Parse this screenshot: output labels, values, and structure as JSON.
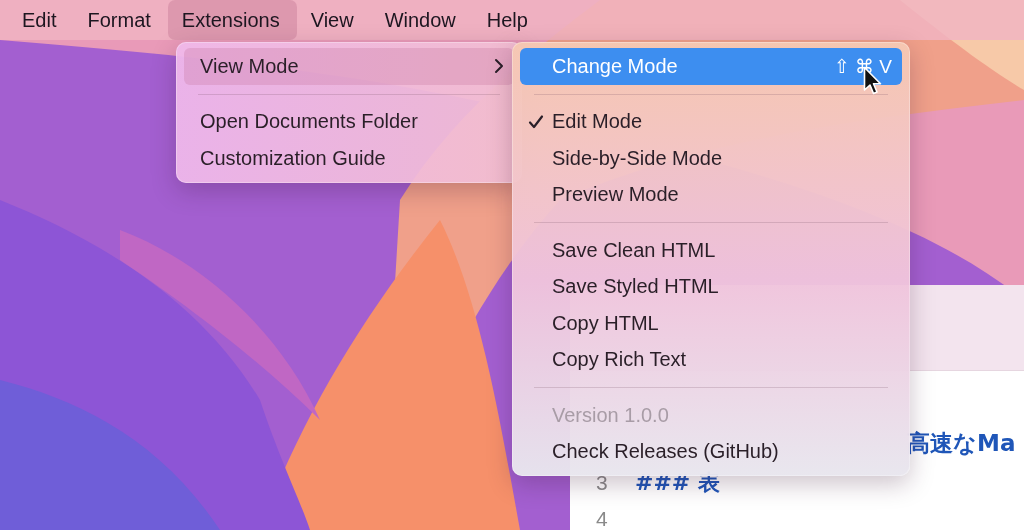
{
  "menu_bar": [
    {
      "label": "Edit",
      "selected": false
    },
    {
      "label": "Format",
      "selected": false
    },
    {
      "label": "Extensions",
      "selected": true
    },
    {
      "label": "View",
      "selected": false
    },
    {
      "label": "Window",
      "selected": false
    },
    {
      "label": "Help",
      "selected": false
    }
  ],
  "extensions_menu": {
    "items": [
      {
        "kind": "item",
        "label": "View Mode",
        "selected": true,
        "has_submenu": true
      },
      {
        "kind": "separator"
      },
      {
        "kind": "item",
        "label": "Open Documents Folder",
        "selected": false,
        "has_submenu": false
      },
      {
        "kind": "item",
        "label": "Customization Guide",
        "selected": false,
        "has_submenu": false
      }
    ]
  },
  "view_mode_submenu": {
    "items": [
      {
        "kind": "item",
        "label": "Change Mode",
        "selected": true,
        "checked": false,
        "disabled": false,
        "shortcut": "⇧ ⌘ V"
      },
      {
        "kind": "separator"
      },
      {
        "kind": "item",
        "label": "Edit Mode",
        "selected": false,
        "checked": true,
        "disabled": false
      },
      {
        "kind": "item",
        "label": "Side-by-Side Mode",
        "selected": false,
        "checked": false,
        "disabled": false
      },
      {
        "kind": "item",
        "label": "Preview Mode",
        "selected": false,
        "checked": false,
        "disabled": false
      },
      {
        "kind": "separator"
      },
      {
        "kind": "item",
        "label": "Save Clean HTML",
        "selected": false,
        "checked": false,
        "disabled": false
      },
      {
        "kind": "item",
        "label": "Save Styled HTML",
        "selected": false,
        "checked": false,
        "disabled": false
      },
      {
        "kind": "item",
        "label": "Copy HTML",
        "selected": false,
        "checked": false,
        "disabled": false
      },
      {
        "kind": "item",
        "label": "Copy Rich Text",
        "selected": false,
        "checked": false,
        "disabled": false
      },
      {
        "kind": "separator"
      },
      {
        "kind": "item",
        "label": "Version 1.0.0",
        "selected": false,
        "checked": false,
        "disabled": true
      },
      {
        "kind": "item",
        "label": "Check Releases (GitHub)",
        "selected": false,
        "checked": false,
        "disabled": false
      }
    ]
  },
  "editor": {
    "heading": "高速なMa",
    "lines": [
      {
        "number": "3",
        "text": "### 表"
      },
      {
        "number": "4"
      }
    ]
  }
}
